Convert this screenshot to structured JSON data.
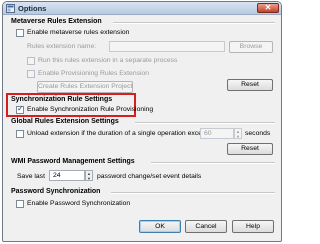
{
  "window": {
    "title": "Options",
    "close_glyph": "✕"
  },
  "metaverse": {
    "heading": "Metaverse Rules Extension",
    "enable_label": "Enable metaverse rules extension",
    "name_label": "Rules extension name:",
    "browse_label": "Browse",
    "separate_process_label": "Run this rules extension in a separate process",
    "provisioning_label": "Enable Provisioning Rules Extension",
    "create_project_label": "Create Rules Extension Project",
    "reset_label": "Reset"
  },
  "sync": {
    "heading": "Synchronization Rule Settings",
    "enable_label": "Enable Synchronization Rule Provisioning",
    "checked": true
  },
  "global": {
    "heading": "Global Rules Extension Settings",
    "unload_label": "Unload extension if the duration of a single operation exceeds:",
    "unload_value": "60",
    "seconds_label": "seconds",
    "reset_label": "Reset"
  },
  "wmi": {
    "heading": "WMI Password Management Settings",
    "save_last_label": "Save last",
    "save_last_value": "24",
    "details_label": "password change/set event details"
  },
  "password": {
    "heading": "Password Synchronization",
    "enable_label": "Enable Password Synchronization"
  },
  "footer": {
    "ok_label": "OK",
    "cancel_label": "Cancel",
    "help_label": "Help"
  }
}
